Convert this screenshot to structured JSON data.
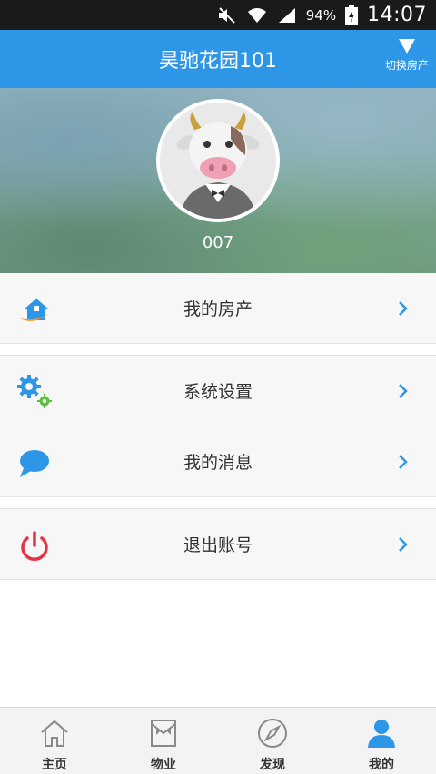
{
  "status_bar": {
    "battery": "94%",
    "time": "14:07"
  },
  "header": {
    "title": "昊驰花园101",
    "switch_label": "切换房产"
  },
  "profile": {
    "username": "007"
  },
  "menu": {
    "items": [
      {
        "label": "我的房产",
        "icon": "house-icon"
      },
      {
        "label": "系统设置",
        "icon": "gears-icon"
      },
      {
        "label": "我的消息",
        "icon": "chat-bubble-icon"
      },
      {
        "label": "退出账号",
        "icon": "power-icon"
      }
    ]
  },
  "bottom_nav": {
    "items": [
      {
        "label": "主页",
        "icon": "home-icon"
      },
      {
        "label": "物业",
        "icon": "property-icon"
      },
      {
        "label": "发现",
        "icon": "compass-icon"
      },
      {
        "label": "我的",
        "icon": "user-icon"
      }
    ],
    "active_index": 3
  },
  "colors": {
    "primary": "#2e96e6",
    "chevron": "#2e96e6",
    "power": "#e53345",
    "gear_green": "#5cbf3a"
  }
}
